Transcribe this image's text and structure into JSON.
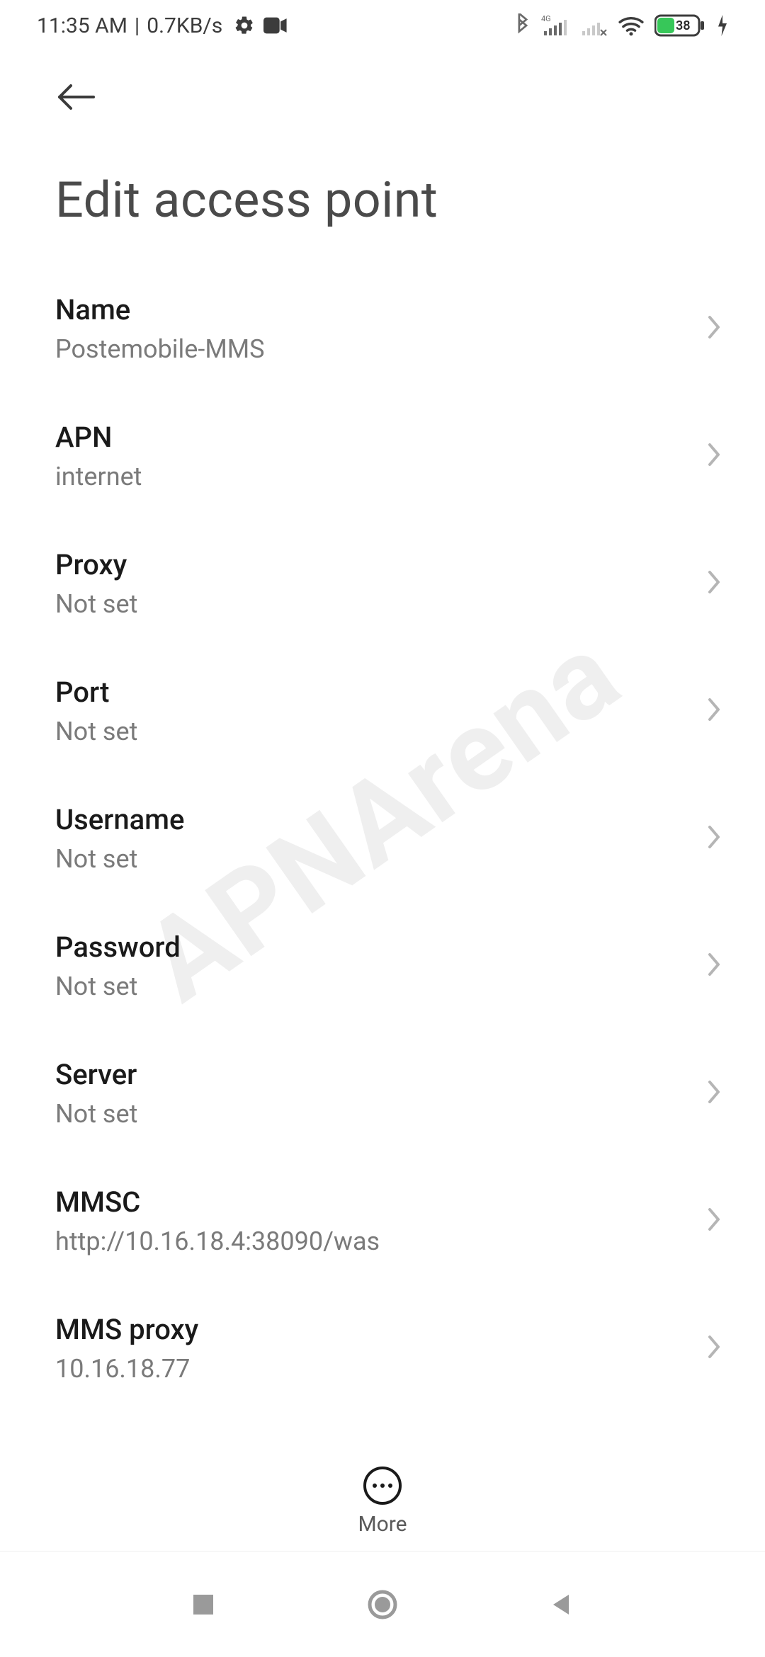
{
  "status": {
    "time": "11:35 AM",
    "sep": "|",
    "net_speed": "0.7KB/s",
    "battery_pct": "38"
  },
  "header": {
    "title": "Edit access point"
  },
  "rows": [
    {
      "label": "Name",
      "value": "Postemobile-MMS"
    },
    {
      "label": "APN",
      "value": "internet"
    },
    {
      "label": "Proxy",
      "value": "Not set"
    },
    {
      "label": "Port",
      "value": "Not set"
    },
    {
      "label": "Username",
      "value": "Not set"
    },
    {
      "label": "Password",
      "value": "Not set"
    },
    {
      "label": "Server",
      "value": "Not set"
    },
    {
      "label": "MMSC",
      "value": "http://10.16.18.4:38090/was"
    },
    {
      "label": "MMS proxy",
      "value": "10.16.18.77"
    }
  ],
  "action": {
    "more_label": "More"
  },
  "watermark": {
    "text": "APNArena"
  }
}
